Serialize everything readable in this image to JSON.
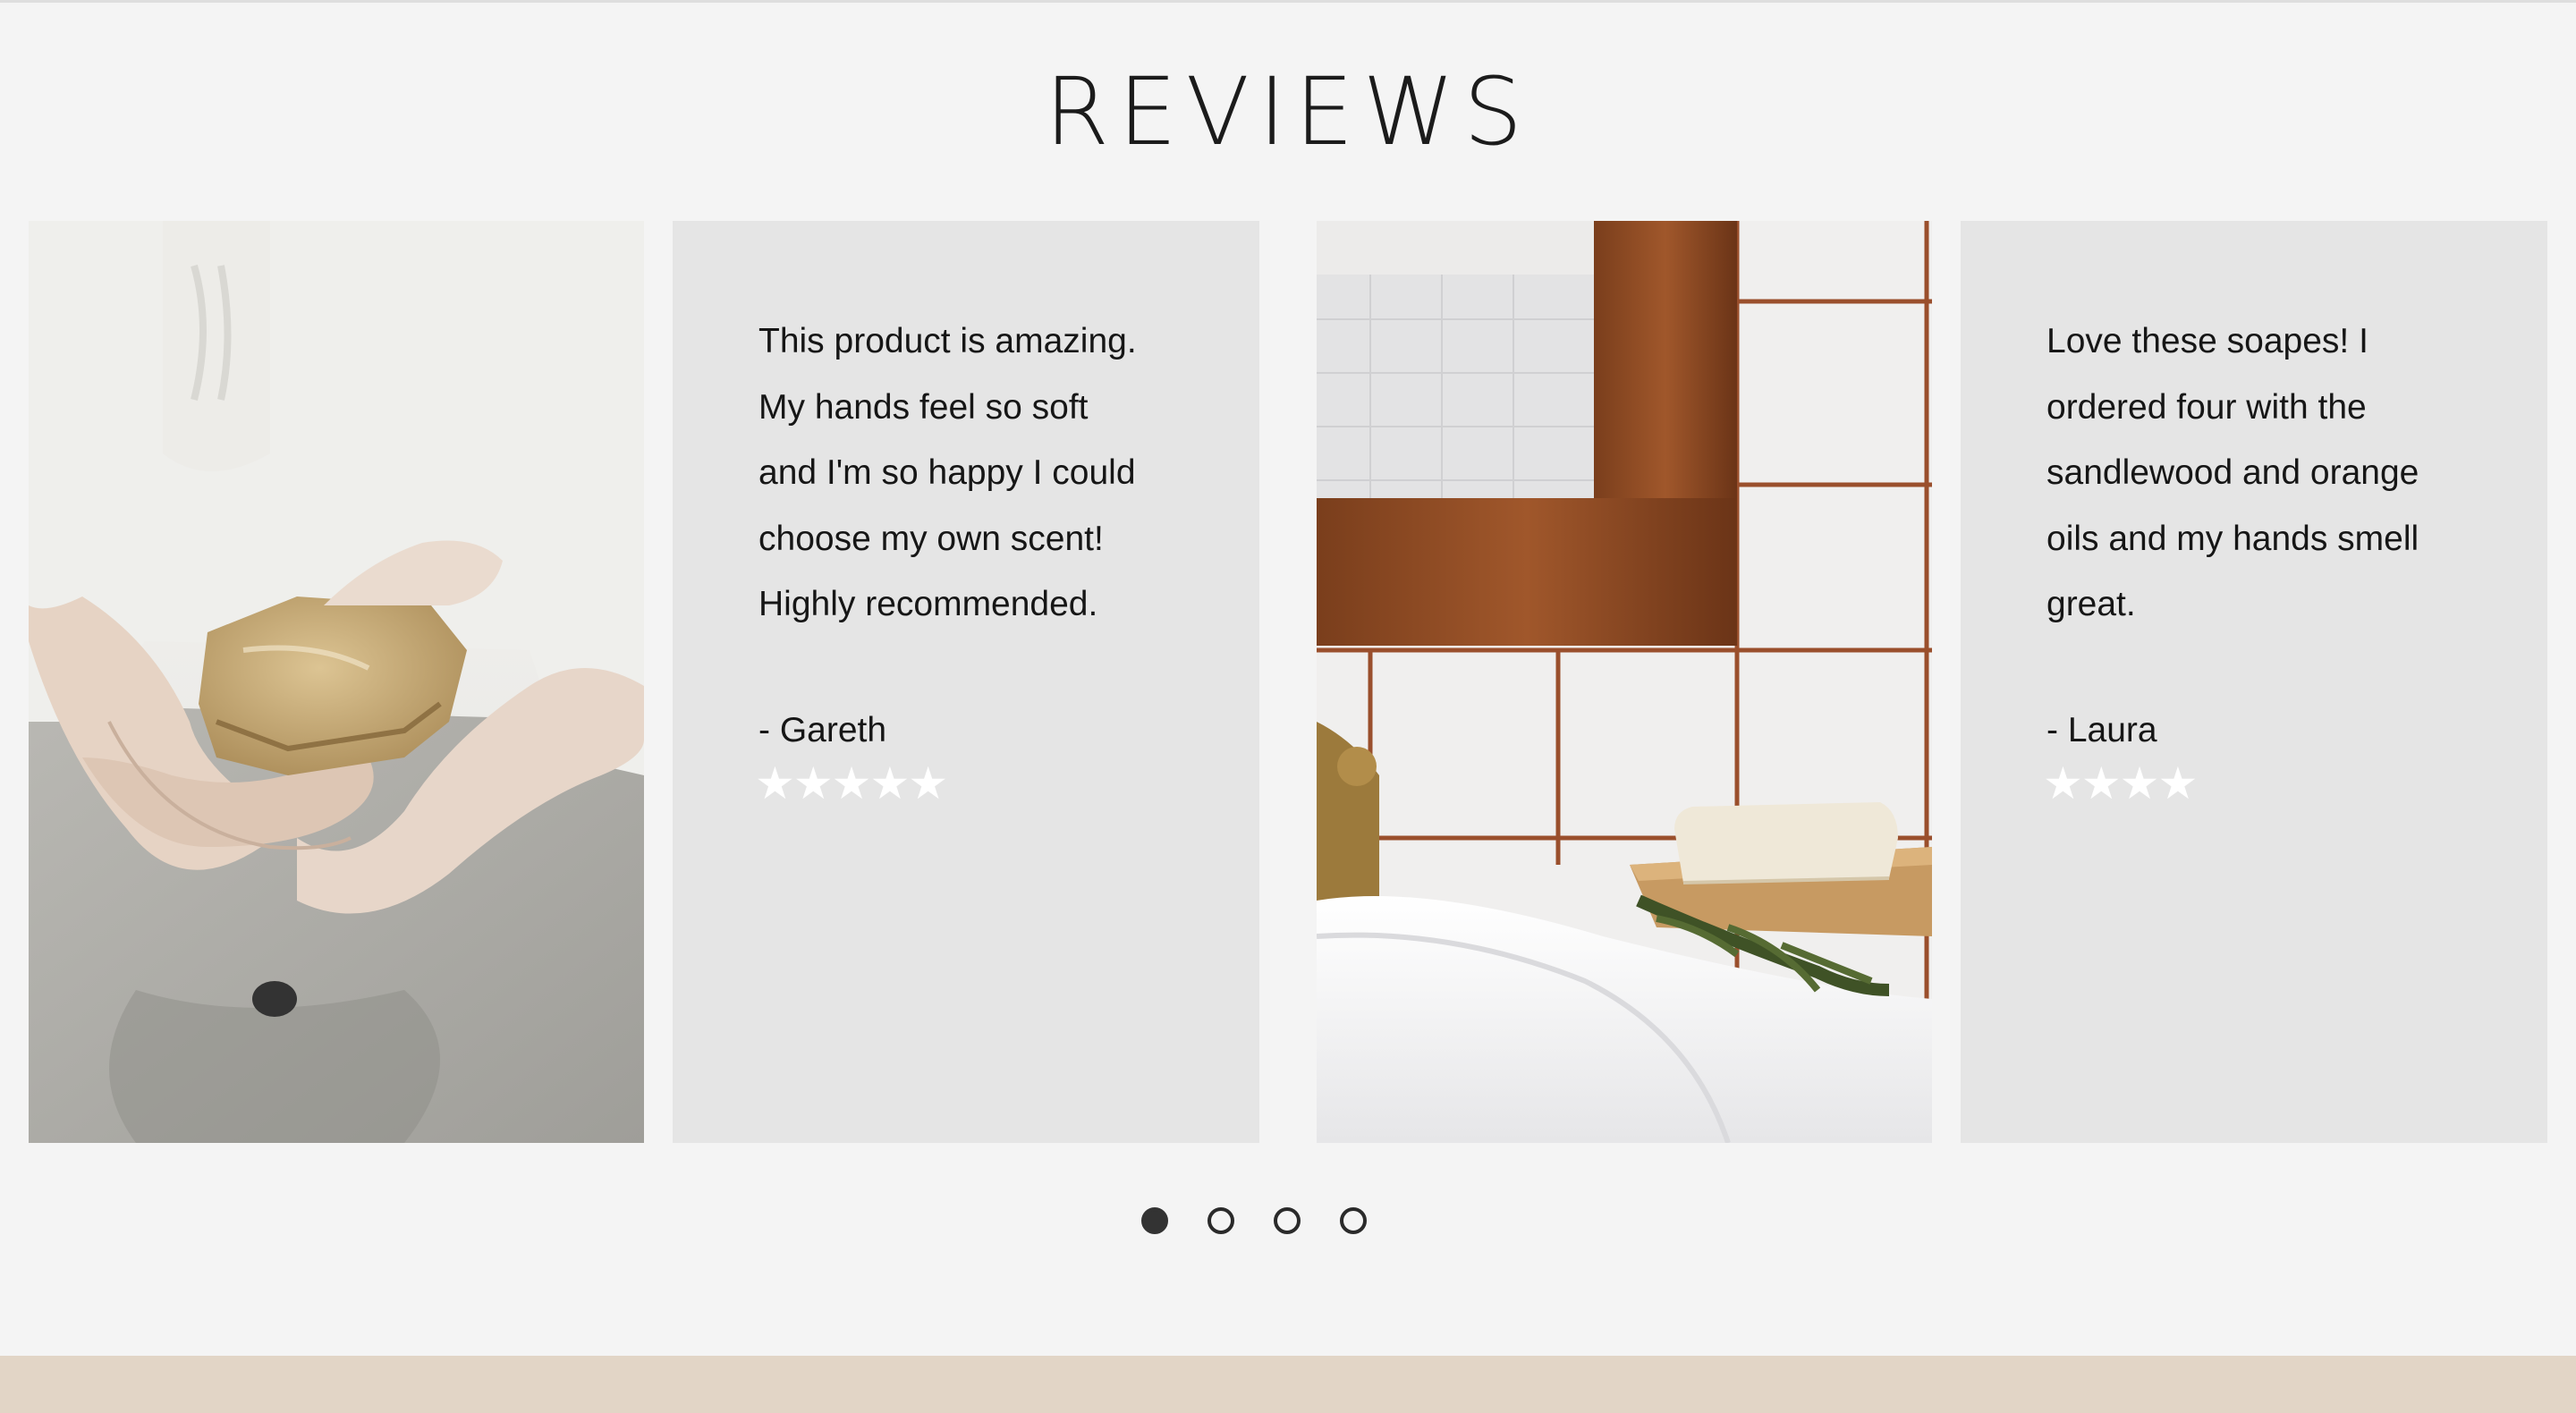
{
  "section": {
    "title": "REVIEWS"
  },
  "reviews": [
    {
      "text_lines": [
        "This product is amazing.",
        "My hands feel so soft",
        "and I'm so happy I could",
        "choose my own scent!",
        "Highly recommended."
      ],
      "author": "- Gareth",
      "stars": "★★★★★",
      "rating": 5
    },
    {
      "text_lines": [
        "Love these soapes! I",
        "ordered four with the",
        "sandlewood and orange",
        "oils and my hands smell",
        "great."
      ],
      "author": "- Laura",
      "stars": "★★★★",
      "rating": 4
    }
  ],
  "carousel": {
    "page_count": 4,
    "active_index": 0
  },
  "colors": {
    "page_background": "#f4f4f4",
    "card_background": "#e5e5e5",
    "footer_band": "#e2d5c6",
    "dot_active": "#333333"
  },
  "images": [
    {
      "name": "hands-holding-soap-photo"
    },
    {
      "name": "bathroom-soap-dish-photo"
    }
  ]
}
